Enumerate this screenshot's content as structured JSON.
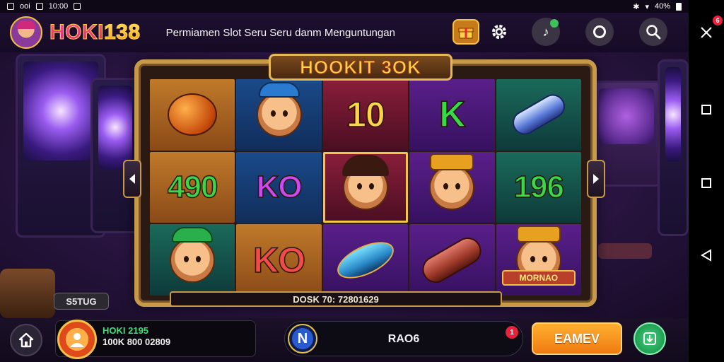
{
  "status_bar": {
    "left_text": "ooi",
    "time": "10:00",
    "battery": "40%"
  },
  "header": {
    "brand_prefix": "HOKI",
    "brand_number": "138",
    "tagline": "Permiamen Slot Seru Seru danm Menguntungan"
  },
  "game": {
    "title": "HOOKIT 3OK",
    "reels": [
      [
        {
          "type": "object",
          "label": "bell"
        },
        {
          "type": "text",
          "text": "490",
          "color": "#37d94a"
        },
        {
          "type": "character",
          "label": "bear-green-hat"
        }
      ],
      [
        {
          "type": "character",
          "label": "boy-blue-cap"
        },
        {
          "type": "text",
          "text": "KO",
          "color": "#c94af0"
        },
        {
          "type": "text",
          "text": "KO",
          "color": "#f04a4a"
        }
      ],
      [
        {
          "type": "text",
          "text": "10",
          "color": "#ffd24a"
        },
        {
          "type": "character",
          "label": "girl-red"
        },
        {
          "type": "object",
          "label": "fish"
        }
      ],
      [
        {
          "type": "text",
          "text": "K",
          "color": "#37d94a"
        },
        {
          "type": "character",
          "label": "cat-boy"
        },
        {
          "type": "object",
          "label": "log"
        }
      ],
      [
        {
          "type": "object",
          "label": "tube"
        },
        {
          "type": "text",
          "text": "196",
          "color": "#37d94a"
        },
        {
          "type": "character",
          "label": "bear-crown",
          "banner": "MORNAO"
        }
      ]
    ],
    "info_text": "DOSK 70: 72801629",
    "setting_label": "S5TUG"
  },
  "bottom": {
    "account_user": "HOKI 2195",
    "account_balance": "100K 800 02809",
    "account_extra": "",
    "promo_label": "RAO6",
    "promo_badge": "1",
    "cta_label": "EAMEV"
  },
  "nav": {
    "badge": "6"
  },
  "colors": {
    "accent": "#f07a10",
    "brand_pink": "#d81e6a",
    "gold": "#c79a4a"
  }
}
